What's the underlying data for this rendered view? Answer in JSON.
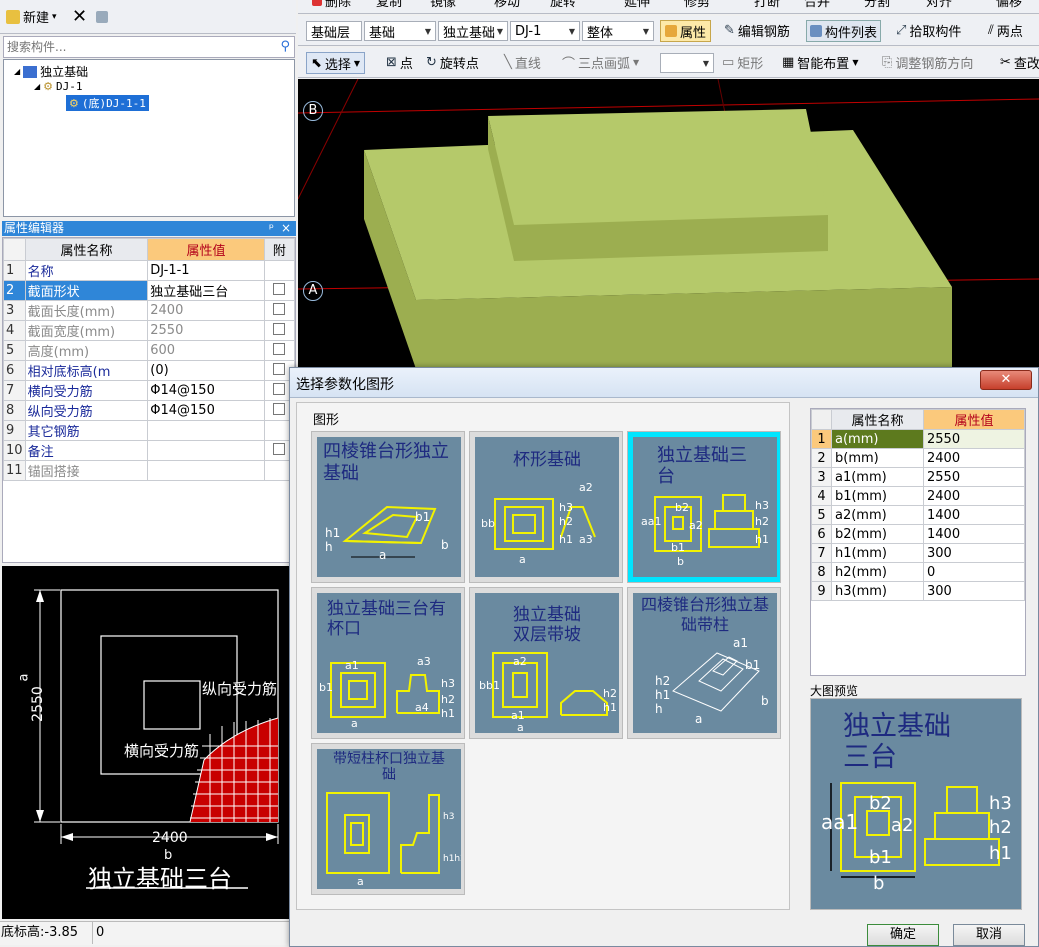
{
  "left_toolbar": {
    "new_label": "新建",
    "new_arrow": "▾"
  },
  "search": {
    "placeholder": "搜索构件..."
  },
  "tree": {
    "root": "独立基础",
    "child": "DJ-1",
    "leaf": "(底)DJ-1-1"
  },
  "prop_editor": {
    "title": "属性编辑器",
    "pin": "ᵖ",
    "close": "×",
    "col_name": "属性名称",
    "col_value": "属性值",
    "col_attach": "附",
    "rows": [
      {
        "n": "1",
        "name": "名称",
        "value": "DJ-1-1",
        "gray": false,
        "check": false
      },
      {
        "n": "2",
        "name": "截面形状",
        "value": "独立基础三台",
        "gray": false,
        "check": true
      },
      {
        "n": "3",
        "name": "截面长度(mm)",
        "value": "2400",
        "gray": true,
        "check": true
      },
      {
        "n": "4",
        "name": "截面宽度(mm)",
        "value": "2550",
        "gray": true,
        "check": true
      },
      {
        "n": "5",
        "name": "高度(mm)",
        "value": "600",
        "gray": true,
        "check": true
      },
      {
        "n": "6",
        "name": "相对底标高(m",
        "value": "(0)",
        "gray": false,
        "check": true
      },
      {
        "n": "7",
        "name": "横向受力筋",
        "value": "Φ14@150",
        "gray": false,
        "check": true
      },
      {
        "n": "8",
        "name": "纵向受力筋",
        "value": "Φ14@150",
        "gray": false,
        "check": true
      },
      {
        "n": "9",
        "name": "其它钢筋",
        "value": "",
        "gray": false,
        "check": false
      },
      {
        "n": "10",
        "name": "备注",
        "value": "",
        "gray": false,
        "check": true
      },
      {
        "n": "11",
        "name": "锚固搭接",
        "value": "",
        "gray": true,
        "check": false
      }
    ]
  },
  "preview": {
    "dim_v_label": "a",
    "dim_v_value": "2550",
    "dim_h_value": "2400",
    "dim_h_label": "b",
    "label_long": "纵向受力筋",
    "label_trans": "横向受力筋",
    "caption": "独立基础三台"
  },
  "status": {
    "elevation": "底标高:-3.85",
    "value": "0"
  },
  "top_toolbar1": {
    "delete": "删除",
    "copy": "复制",
    "mirror": "镜像",
    "move": "移动",
    "rotate": "旋转",
    "extend": "延伸",
    "trim": "修剪",
    "break": "打断",
    "merge": "合并",
    "split": "分割",
    "align": "对齐",
    "offset": "偏移"
  },
  "top_toolbar2": {
    "layer": "基础层",
    "category": "基础",
    "type": "独立基础",
    "component": "DJ-1",
    "scope": "整体",
    "properties": "属性",
    "edit_rebar": "编辑钢筋",
    "comp_list": "构件列表",
    "pick": "拾取构件",
    "two_points": "两点"
  },
  "top_toolbar3": {
    "select": "选择",
    "point": "点",
    "rotate_point": "旋转点",
    "line": "直线",
    "arc": "三点画弧",
    "rect": "矩形",
    "smart": "智能布置",
    "adjust": "调整钢筋方向",
    "query": "查改"
  },
  "viewport": {
    "axis_b": "B",
    "axis_a": "A"
  },
  "dialog": {
    "title": "选择参数化图形",
    "close": "✕",
    "group_label": "图形",
    "cards": [
      {
        "title": "四棱锥台形独立基础"
      },
      {
        "title": "杯形基础"
      },
      {
        "title": "独立基础三台"
      },
      {
        "title": "独立基础三台有杯口"
      },
      {
        "title": "独立基础双层带坡"
      },
      {
        "title": "四棱锥台形独立基础带柱"
      },
      {
        "title": "带短柱杯口独立基础"
      }
    ],
    "table": {
      "col_name": "属性名称",
      "col_value": "属性值",
      "rows": [
        {
          "n": "1",
          "name": "a(mm)",
          "value": "2550"
        },
        {
          "n": "2",
          "name": "b(mm)",
          "value": "2400"
        },
        {
          "n": "3",
          "name": "a1(mm)",
          "value": "2550"
        },
        {
          "n": "4",
          "name": "b1(mm)",
          "value": "2400"
        },
        {
          "n": "5",
          "name": "a2(mm)",
          "value": "1400"
        },
        {
          "n": "6",
          "name": "b2(mm)",
          "value": "1400"
        },
        {
          "n": "7",
          "name": "h1(mm)",
          "value": "300"
        },
        {
          "n": "8",
          "name": "h2(mm)",
          "value": "0"
        },
        {
          "n": "9",
          "name": "h3(mm)",
          "value": "300"
        }
      ]
    },
    "preview_label": "大图预览",
    "big_title": "独立基础三台",
    "ok": "确定",
    "cancel": "取消"
  },
  "colors": {
    "accent_select": "#00e5ff",
    "header_value": "#fbc97c",
    "card_bg": "#6a8aa0",
    "title_bar": "#1a6fc9"
  }
}
